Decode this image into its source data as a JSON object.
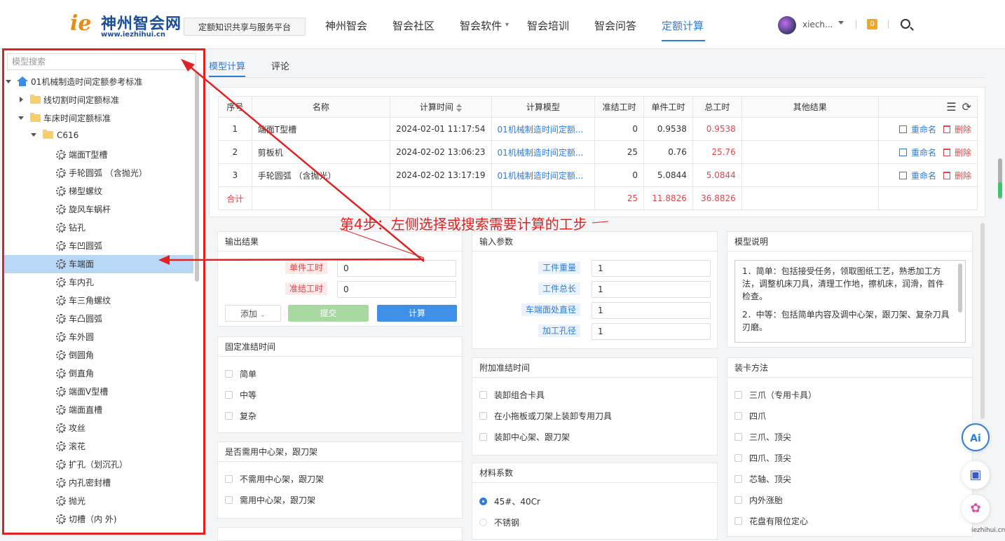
{
  "header": {
    "logo_mark": "ie",
    "logo_cn": "神州智会网",
    "logo_url": "www.iezhihui.cn",
    "slogan": "定额知识共享与服务平台",
    "nav": [
      "神州智会",
      "智会社区",
      "智会软件",
      "智会培训",
      "智会问答",
      "定额计算"
    ],
    "active_nav": "定额计算",
    "user": "xiech...",
    "msg_count": "0"
  },
  "sidebar": {
    "search_placeholder": "模型搜索",
    "root": "01机械制造时间定额参考标准",
    "folders": [
      "线切割时间定额标准",
      "车床时间定额标准",
      "C616"
    ],
    "items": [
      "端面T型槽",
      "手轮圆弧 （含抛光）",
      "梯型螺纹",
      "旋风车蜗杆",
      "钻孔",
      "车凹圆弧",
      "车端面",
      "车内孔",
      "车三角螺纹",
      "车凸圆弧",
      "车外圆",
      "倒圆角",
      "倒直角",
      "端面V型槽",
      "端面直槽",
      "攻丝",
      "滚花",
      "扩孔（划沉孔）",
      "内孔密封槽",
      "抛光",
      "切槽（内 外)"
    ],
    "selected": "车端面"
  },
  "tabs": [
    "模型计算",
    "评论"
  ],
  "table": {
    "headers": [
      "序号",
      "名称",
      "计算时间",
      "计算模型",
      "准结工时",
      "单件工时",
      "总工时",
      "其他结果"
    ],
    "rows": [
      {
        "no": "1",
        "name": "端面T型槽",
        "time": "2024-02-01 11:17:54",
        "model": "01机械制造时间定额...",
        "setup": "0",
        "unit": "0.9538",
        "total": "0.9538"
      },
      {
        "no": "2",
        "name": "剪板机",
        "time": "2024-02-02 13:06:23",
        "model": "01机械制造时间定额...",
        "setup": "25",
        "unit": "0.76",
        "total": "25.76"
      },
      {
        "no": "3",
        "name": "手轮圆弧 （含抛光）",
        "time": "2024-02-02 13:17:19",
        "model": "01机械制造时间定额...",
        "setup": "0",
        "unit": "5.0844",
        "total": "5.0844"
      }
    ],
    "sum": {
      "label": "合计",
      "setup": "25",
      "unit": "11.8826",
      "total": "36.8826"
    },
    "rename": "重命名",
    "delete": "删除"
  },
  "annotation": "第4步：左侧选择或搜索需要计算的工步",
  "output": {
    "title": "输出结果",
    "unit_label": "单件工时",
    "unit_value": "0",
    "setup_label": "准结工时",
    "setup_value": "0",
    "add": "添加",
    "submit": "提交",
    "calc": "计算"
  },
  "input": {
    "title": "输入参数",
    "params": [
      {
        "label": "工件重量",
        "value": "1"
      },
      {
        "label": "工件总长",
        "value": "1"
      },
      {
        "label": "车端面处直径",
        "value": "1"
      },
      {
        "label": "加工孔径",
        "value": "1"
      }
    ]
  },
  "model_desc": {
    "title": "模型说明",
    "p1": "1．简单：包括接受任务，领取图纸工艺，熟悉加工方法，调整机床刀具，清理工作地，擦机床，润滑，首件检查。",
    "p2": "2．中等：包括简单内容及调中心架，跟刀架、复杂刀具刃磨。"
  },
  "fixed_time": {
    "title": "固定准结时间",
    "options": [
      "简单",
      "中等",
      "复杂"
    ]
  },
  "extra_time": {
    "title": "附加准结时间",
    "options": [
      "装卸组合卡具",
      "在小拖板或刀架上装卸专用刀具",
      "装卸中心架、跟刀架"
    ]
  },
  "clamp": {
    "title": "装卡方法",
    "options": [
      "三爪（专用卡具）",
      "四爪",
      "三爪、顶尖",
      "四爪、顶尖",
      "芯轴、顶尖",
      "内外涨胎",
      "花盘有限位定心"
    ]
  },
  "rest": {
    "title": "是否需用中心架，跟刀架",
    "options": [
      "不需用中心架，跟刀架",
      "需用中心架，跟刀架"
    ]
  },
  "material": {
    "title": "材料系数",
    "options": [
      "45#、40Cr",
      "不锈钢"
    ],
    "selected": "45#、40Cr"
  },
  "float_ai": "Ai",
  "watermark": "iezhihui.cn",
  "colors": {
    "accent": "#2f7bd8",
    "danger": "#e0464b",
    "annotation": "#e02222",
    "selected_row": "#b9d8f7"
  }
}
